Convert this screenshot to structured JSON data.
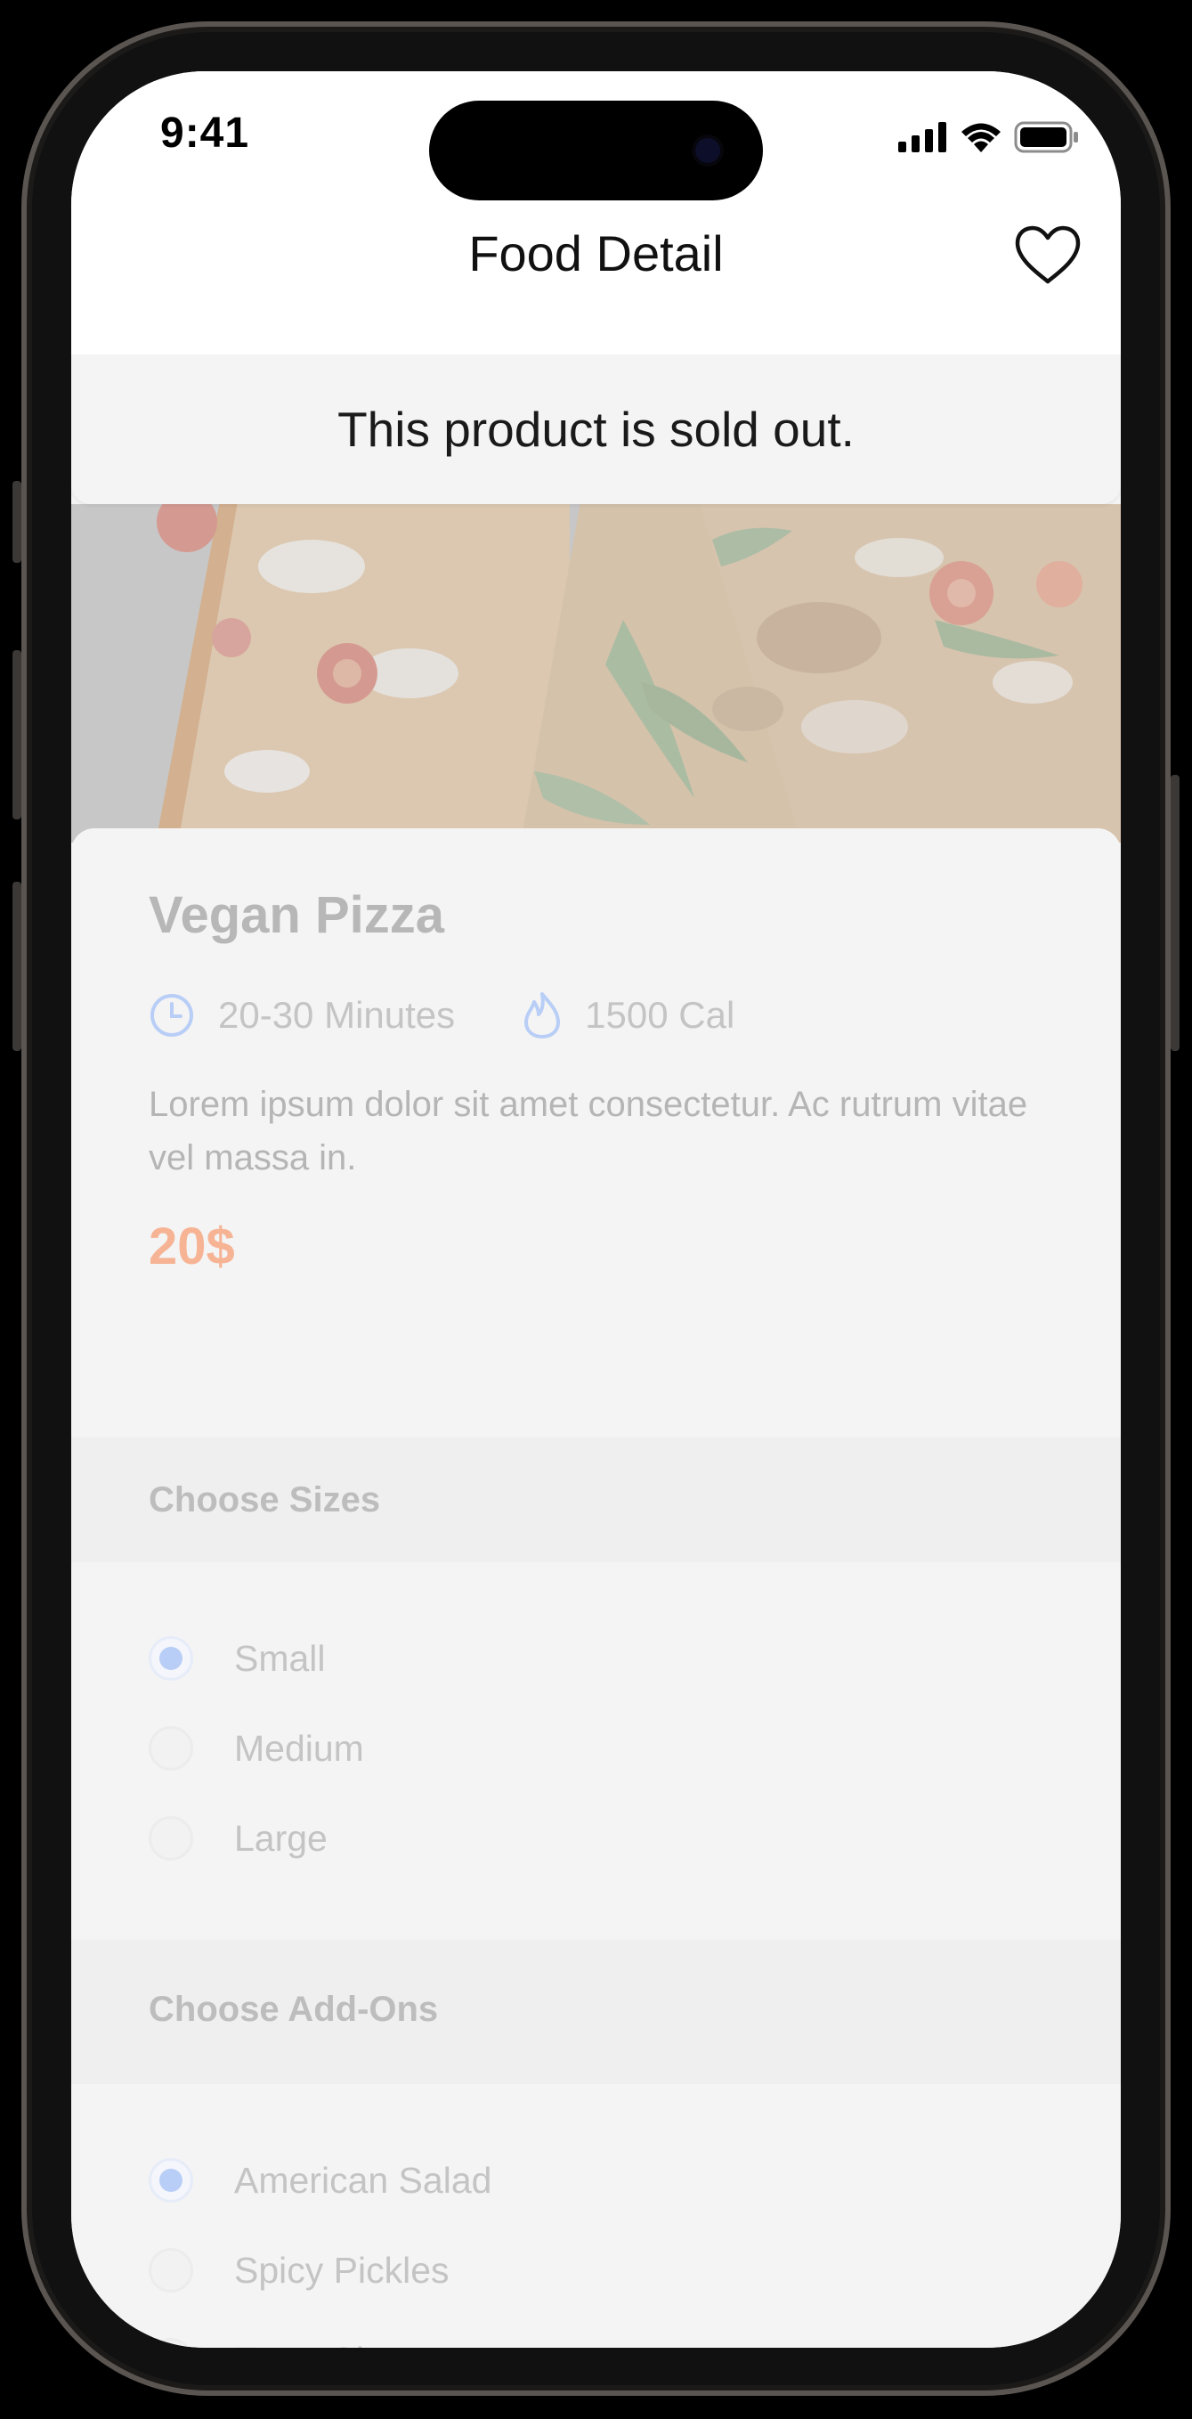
{
  "status_bar": {
    "time": "9:41",
    "icons": [
      "signal-icon",
      "wifi-icon",
      "battery-icon"
    ]
  },
  "header": {
    "title": "Food Detail",
    "favorite_icon": "heart-outline-icon"
  },
  "banner": {
    "message": "This product is sold out."
  },
  "hero": {
    "image": "pizza-photo"
  },
  "product": {
    "name": "Vegan Pizza",
    "time": "20-30 Minutes",
    "time_icon": "clock-icon",
    "calories": "1500 Cal",
    "calories_icon": "flame-icon",
    "description": "Lorem ipsum dolor sit amet consectetur. Ac rutrum vitae vel massa in.",
    "price": "20$"
  },
  "sizes": {
    "title": "Choose Sizes",
    "options": [
      {
        "label": "Small",
        "selected": true
      },
      {
        "label": "Medium",
        "selected": false
      },
      {
        "label": "Large",
        "selected": false
      }
    ]
  },
  "addons": {
    "title": "Choose Add-Ons",
    "options": [
      {
        "label": "American Salad",
        "selected": true
      },
      {
        "label": "Spicy Pickles",
        "selected": false
      },
      {
        "label": "Extra Cheese",
        "selected": false
      }
    ]
  },
  "colors": {
    "accent_blue": "#b9cef6",
    "price_orange": "#f6b495",
    "background": "#f4f4f4"
  }
}
